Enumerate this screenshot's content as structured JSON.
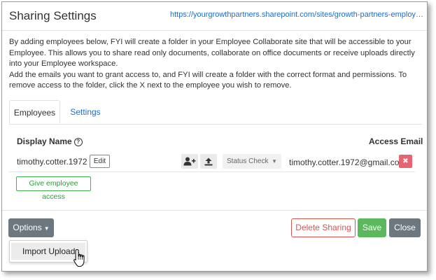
{
  "header": {
    "title": "Sharing Settings",
    "site_url": "https://yourgrowthpartners.sharepoint.com/sites/growth-partners-employee-collabo..."
  },
  "description": {
    "paragraph_1": "By adding employees below, FYI will create a folder in your Employee Collaborate site that will be accessible to your Employee. This allows you to share read only documents, collaborate on office documents or receive uploads directly into your Employee workspace.",
    "paragraph_2": "Add the emails you want to grant access to, and FYI will create a folder with the correct format and permissions. To remove access to the folder, click the X next to the employee you wish to remove."
  },
  "tabs": [
    {
      "label": "Employees",
      "active": true
    },
    {
      "label": "Settings",
      "active": false
    }
  ],
  "table": {
    "col_display_name": "Display Name",
    "col_access_email": "Access Email",
    "help_icon": "question-circle-icon",
    "rows": [
      {
        "display_name": "timothy.cotter.1972",
        "edit_label": "Edit",
        "add_user_icon": "user-plus-icon",
        "upload_icon": "upload-icon",
        "status_label": "Status Check",
        "email": "timothy.cotter.1972@gmail.com",
        "remove_icon": "close-icon"
      }
    ]
  },
  "give_access_label": "Give employee access",
  "footer": {
    "options_label": "Options",
    "options_menu": [
      "Import Uploads"
    ],
    "delete_label": "Delete Sharing",
    "save_label": "Save",
    "close_label": "Close"
  },
  "colors": {
    "link": "#1f6fc6",
    "danger": "#d9534f",
    "success": "#5cb85c",
    "secondary": "#6c7780",
    "remove_button": "#e56572"
  }
}
